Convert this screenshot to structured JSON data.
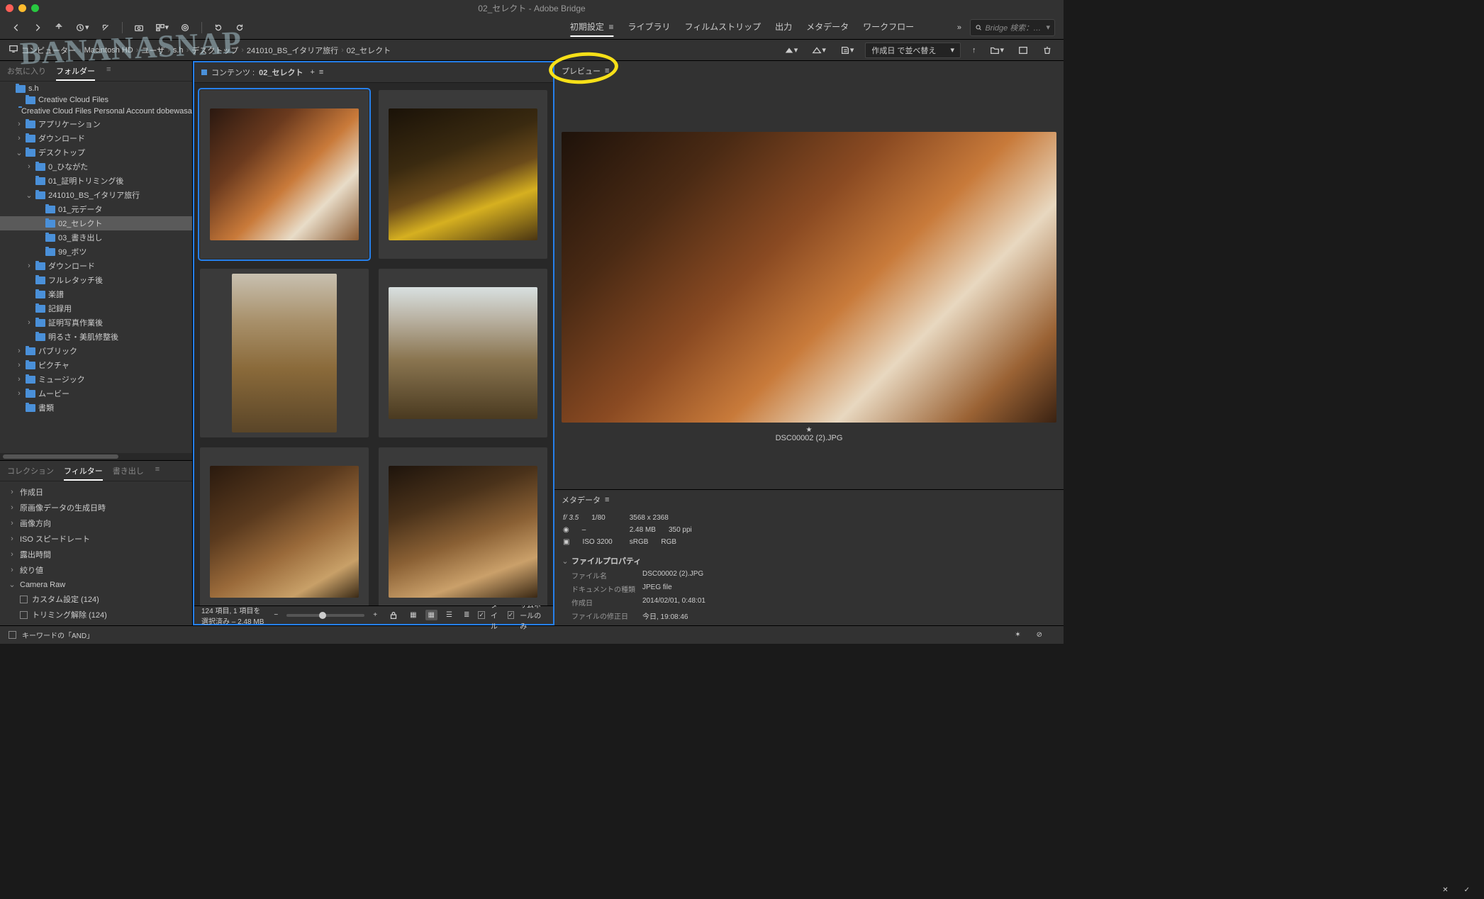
{
  "window": {
    "title": "02_セレクト - Adobe Bridge"
  },
  "watermark": "BANANASNAP",
  "toolbar": {
    "workspaces": [
      "初期設定",
      "ライブラリ",
      "フィルムストリップ",
      "出力",
      "メタデータ",
      "ワークフロー"
    ],
    "active_workspace": 0,
    "search_placeholder": "Bridge 検索：現在の..."
  },
  "path": {
    "crumbs": [
      "コンピューター",
      "Macintosh HD",
      "ユーザ",
      "s.h",
      "デスクトップ",
      "241010_BS_イタリア旅行",
      "02_セレクト"
    ],
    "sort_label": "作成日 で並べ替え"
  },
  "left": {
    "tabs_top": {
      "items": [
        "お気に入り",
        "フォルダー"
      ],
      "active": 1
    },
    "tree": [
      {
        "depth": 0,
        "label": "s.h",
        "expanded": true
      },
      {
        "depth": 1,
        "label": "Creative Cloud Files"
      },
      {
        "depth": 1,
        "label": "Creative Cloud Files Personal Account dobewasao@g"
      },
      {
        "depth": 1,
        "label": "アプリケーション",
        "twisty": ">"
      },
      {
        "depth": 1,
        "label": "ダウンロード",
        "twisty": ">"
      },
      {
        "depth": 1,
        "label": "デスクトップ",
        "twisty": "v"
      },
      {
        "depth": 2,
        "label": "0_ひながた",
        "twisty": ">"
      },
      {
        "depth": 2,
        "label": "01_証明トリミング後"
      },
      {
        "depth": 2,
        "label": "241010_BS_イタリア旅行",
        "twisty": "v"
      },
      {
        "depth": 3,
        "label": "01_元データ"
      },
      {
        "depth": 3,
        "label": "02_セレクト",
        "selected": true
      },
      {
        "depth": 3,
        "label": "03_書き出し"
      },
      {
        "depth": 3,
        "label": "99_ボツ"
      },
      {
        "depth": 2,
        "label": "ダウンロード",
        "twisty": ">"
      },
      {
        "depth": 2,
        "label": "フルレタッチ後"
      },
      {
        "depth": 2,
        "label": "楽譜"
      },
      {
        "depth": 2,
        "label": "記録用"
      },
      {
        "depth": 2,
        "label": "証明写真作業後",
        "twisty": ">"
      },
      {
        "depth": 2,
        "label": "明るさ・美肌修整後"
      },
      {
        "depth": 1,
        "label": "パブリック",
        "twisty": ">"
      },
      {
        "depth": 1,
        "label": "ピクチャ",
        "twisty": ">"
      },
      {
        "depth": 1,
        "label": "ミュージック",
        "twisty": ">"
      },
      {
        "depth": 1,
        "label": "ムービー",
        "twisty": ">"
      },
      {
        "depth": 1,
        "label": "書類"
      }
    ],
    "tabs_bottom": {
      "items": [
        "コレクション",
        "フィルター",
        "書き出し"
      ],
      "active": 1
    },
    "filters": [
      {
        "label": "作成日",
        "twisty": ">"
      },
      {
        "label": "原画像データの生成日時",
        "twisty": ">"
      },
      {
        "label": "画像方向",
        "twisty": ">"
      },
      {
        "label": "ISO スピードレート",
        "twisty": ">"
      },
      {
        "label": "露出時間",
        "twisty": ">"
      },
      {
        "label": "絞り値",
        "twisty": ">"
      },
      {
        "label": "Camera Raw",
        "twisty": "v",
        "children": [
          {
            "label": "カスタム設定 (124)"
          },
          {
            "label": "トリミング解除 (124)"
          }
        ]
      }
    ]
  },
  "content": {
    "header_prefix": "コンテンツ :",
    "header_name": "02_セレクト",
    "status": "124 項目, 1 項目を選択済み – 2.48 MB",
    "view_options": {
      "tile": "タイル",
      "thumb_only": "サムネールのみ"
    },
    "thumbs": [
      {
        "selected": true,
        "gradient": "linear-gradient(135deg,#2a1810 0%,#6b3a1e 30%,#c97a3a 55%,#e8dcc8 75%,#8a5a32 100%)",
        "portrait": false
      },
      {
        "gradient": "linear-gradient(160deg,#1a1208 0%,#3a2a10 35%,#6a4a1a 55%,#d6b020 72%,#4a3512 100%)",
        "portrait": false
      },
      {
        "gradient": "linear-gradient(180deg,#c8c0b0 0%,#a8906a 30%,#8a6a3a 60%,#5a4528 100%)",
        "portrait": true
      },
      {
        "gradient": "linear-gradient(180deg,#d8e0e0 0%,#b8b0a0 25%,#8a7550 55%,#4a3a20 100%)",
        "portrait": false
      },
      {
        "gradient": "linear-gradient(150deg,#2a1a0e 0%,#5a3a1e 35%,#9a6a3a 60%,#c8a068 82%,#3a2a16 100%)",
        "portrait": false
      },
      {
        "gradient": "linear-gradient(160deg,#1e140c 0%,#4a321a 30%,#8a6034 55%,#caa06a 78%,#3a2814 100%)",
        "portrait": false
      }
    ]
  },
  "preview": {
    "label": "プレビュー",
    "filename": "DSC00002 (2).JPG",
    "gradient": "linear-gradient(135deg,#1e120a 0%,#4a2a14 22%,#8a4a22 42%,#c87a3a 58%,#e8d8c0 72%,#9a6234 88%,#3a2212 100%)"
  },
  "metadata": {
    "label": "メタデータ",
    "top": {
      "aperture": "f/ 3.5",
      "shutter": "1/80",
      "dims": "3568 x 2368",
      "ev": "–",
      "size": "2.48 MB",
      "ppi": "350 ppi",
      "iso_label": "ISO",
      "iso": "3200",
      "profile": "sRGB",
      "mode": "RGB"
    },
    "section": "ファイルプロパティ",
    "rows": [
      {
        "k": "ファイル名",
        "v": "DSC00002 (2).JPG"
      },
      {
        "k": "ドキュメントの種類",
        "v": "JPEG file"
      },
      {
        "k": "作成日",
        "v": "2014/02/01, 0:48:01"
      },
      {
        "k": "ファイルの修正日",
        "v": "今日, 19:08:46"
      }
    ]
  },
  "footer": {
    "keyword_mode": "キーワードの「AND」"
  }
}
